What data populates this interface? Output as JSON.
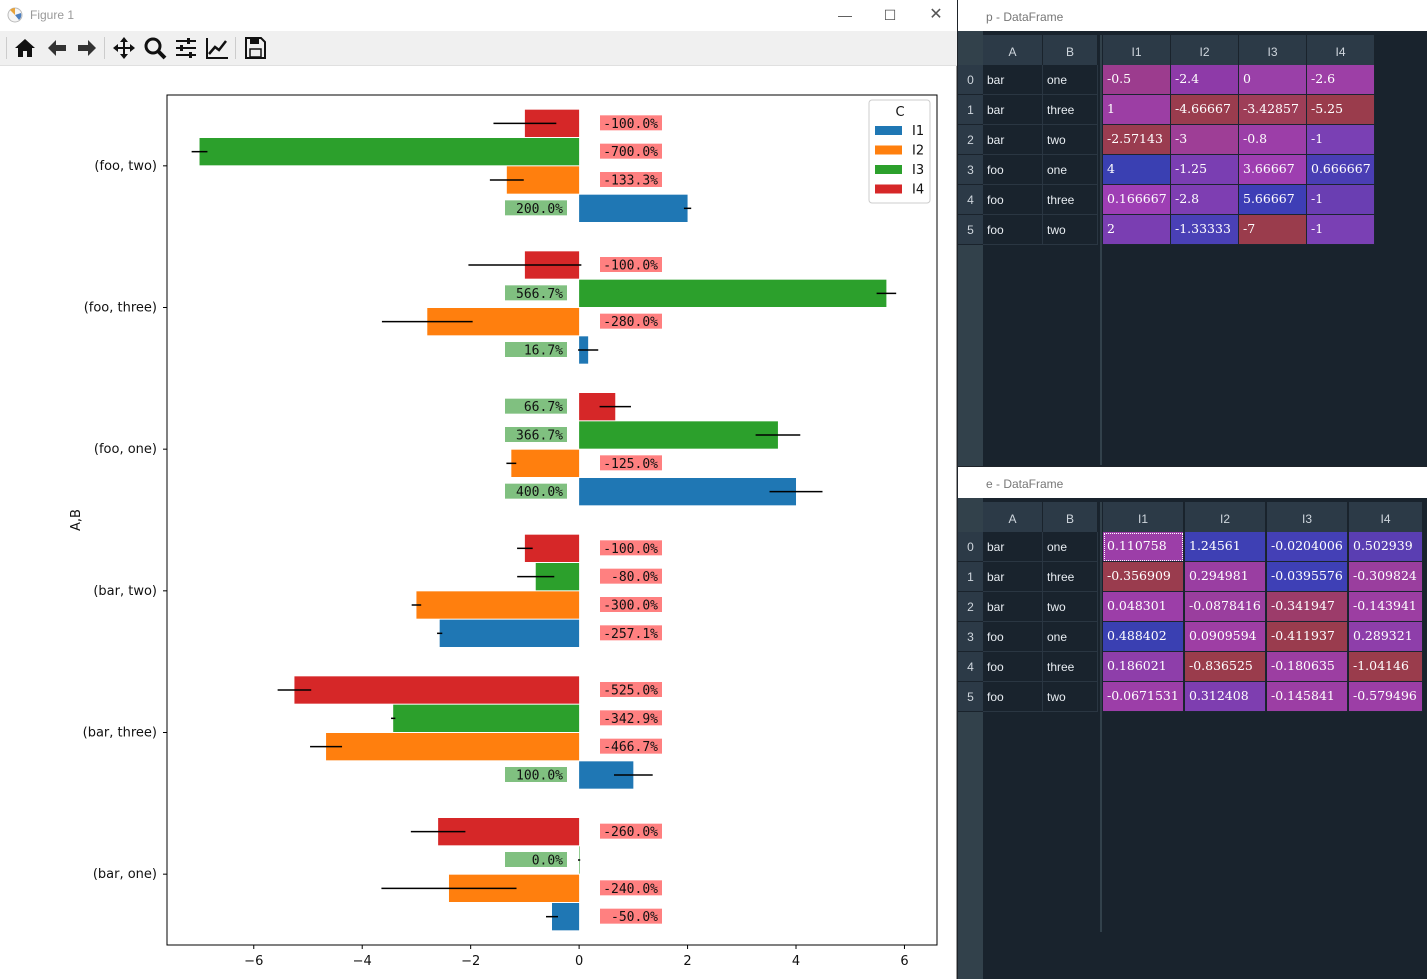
{
  "figure": {
    "title": "Figure 1",
    "toolbar": [
      "home-icon",
      "back-icon",
      "forward-icon",
      "pan-icon",
      "zoom-icon",
      "configure-subplots-icon",
      "edit-axis-icon",
      "save-icon"
    ]
  },
  "chart_data": {
    "type": "bar",
    "orientation": "horizontal",
    "ylabel": "A,B",
    "xlabel": "",
    "categories": [
      "(bar, one)",
      "(bar, three)",
      "(bar, two)",
      "(foo, one)",
      "(foo, three)",
      "(foo, two)"
    ],
    "xlim": [
      -7.6,
      6.6
    ],
    "xticks": [
      -6,
      -4,
      -2,
      0,
      2,
      4,
      6
    ],
    "legend_title": "C",
    "legend_position": "top-right",
    "series": [
      {
        "name": "I1",
        "color": "#1f77b4",
        "values": [
          -0.5,
          1,
          -2.57143,
          4,
          0.166667,
          2
        ],
        "err": [
          0.110758,
          -0.356909,
          0.048301,
          0.488402,
          0.186021,
          -0.0671531
        ],
        "pct": [
          "-50.0%",
          "100.0%",
          "-257.1%",
          "400.0%",
          "16.7%",
          "200.0%"
        ],
        "pct_pos": [
          false,
          true,
          false,
          true,
          true,
          true
        ]
      },
      {
        "name": "I2",
        "color": "#ff7f0e",
        "values": [
          -2.4,
          -4.66667,
          -3,
          -1.25,
          -2.8,
          -1.33333
        ],
        "err": [
          1.24561,
          0.294981,
          -0.0878416,
          0.0909594,
          -0.836525,
          0.312408
        ],
        "pct": [
          "-240.0%",
          "-466.7%",
          "-300.0%",
          "-125.0%",
          "-280.0%",
          "-133.3%"
        ],
        "pct_pos": [
          false,
          false,
          false,
          false,
          false,
          false
        ]
      },
      {
        "name": "I3",
        "color": "#2ca02c",
        "values": [
          0,
          -3.42857,
          -0.8,
          3.66667,
          5.66667,
          -7
        ],
        "err": [
          -0.0204006,
          -0.0395576,
          -0.341947,
          -0.411937,
          -0.180635,
          -0.145841
        ],
        "pct": [
          "0.0%",
          "-342.9%",
          "-80.0%",
          "366.7%",
          "566.7%",
          "-700.0%"
        ],
        "pct_pos": [
          true,
          false,
          false,
          true,
          true,
          false
        ]
      },
      {
        "name": "I4",
        "color": "#d62728",
        "values": [
          -2.6,
          -5.25,
          -1,
          0.666667,
          -1,
          -1
        ],
        "err": [
          0.502939,
          -0.309824,
          -0.143941,
          0.289321,
          -1.04146,
          -0.579496
        ],
        "pct": [
          "-260.0%",
          "-525.0%",
          "-100.0%",
          "66.7%",
          "-100.0%",
          "-100.0%"
        ],
        "pct_pos": [
          false,
          false,
          false,
          true,
          false,
          false
        ]
      }
    ]
  },
  "p_frame": {
    "title": "p - DataFrame",
    "index_header": [
      "A",
      "B"
    ],
    "columns": [
      "I1",
      "I2",
      "I3",
      "I4"
    ],
    "rows": [
      {
        "idx": "0",
        "A": "bar",
        "B": "one",
        "vals": [
          "-0.5",
          "-2.4",
          "0",
          "-2.6"
        ],
        "colors": [
          "#9c3c8e",
          "#8e3aa8",
          "#9a40a8",
          "#9d3fa6"
        ]
      },
      {
        "idx": "1",
        "A": "bar",
        "B": "three",
        "vals": [
          "1",
          "-4.66667",
          "-3.42857",
          "-5.25"
        ],
        "colors": [
          "#9c3ea4",
          "#9a3c4e",
          "#9e3e58",
          "#9a3c4c"
        ]
      },
      {
        "idx": "2",
        "A": "bar",
        "B": "two",
        "vals": [
          "-2.57143",
          "-3",
          "-0.8",
          "-1"
        ],
        "colors": [
          "#9a3c50",
          "#9e3e96",
          "#9c3ea8",
          "#7a40b4"
        ]
      },
      {
        "idx": "3",
        "A": "foo",
        "B": "one",
        "vals": [
          "4",
          "-1.25",
          "3.66667",
          "0.666667"
        ],
        "colors": [
          "#3a40b2",
          "#7a3eb2",
          "#9e3eb0",
          "#4a3eb4"
        ]
      },
      {
        "idx": "4",
        "A": "foo",
        "B": "three",
        "vals": [
          "0.166667",
          "-2.8",
          "5.66667",
          "-1"
        ],
        "colors": [
          "#9e3eb4",
          "#7e3eb2",
          "#3e3eb6",
          "#6a3eb2"
        ]
      },
      {
        "idx": "5",
        "A": "foo",
        "B": "two",
        "vals": [
          "2",
          "-1.33333",
          "-7",
          "-1"
        ],
        "colors": [
          "#7a3eb2",
          "#4a40b6",
          "#9a3c4c",
          "#7a40b4"
        ]
      }
    ]
  },
  "e_frame": {
    "title": "e - DataFrame",
    "index_header": [
      "A",
      "B"
    ],
    "columns": [
      "I1",
      "I2",
      "I3",
      "I4"
    ],
    "rows": [
      {
        "idx": "0",
        "A": "bar",
        "B": "one",
        "vals": [
          "0.110758",
          "1.24561",
          "-0.0204006",
          "0.502939"
        ],
        "colors": [
          "#9c3ea8",
          "#3e40b4",
          "#4440b6",
          "#5a3eb2"
        ]
      },
      {
        "idx": "1",
        "A": "bar",
        "B": "three",
        "vals": [
          "-0.356909",
          "0.294981",
          "-0.0395576",
          "-0.309824"
        ],
        "colors": [
          "#9a3c4e",
          "#9a3ea2",
          "#3e40b6",
          "#9a3e9e"
        ]
      },
      {
        "idx": "2",
        "A": "bar",
        "B": "two",
        "vals": [
          "0.048301",
          "-0.0878416",
          "-0.341947",
          "-0.143941"
        ],
        "colors": [
          "#9c3ea8",
          "#9a3e9e",
          "#9c3c6a",
          "#9c3ea2"
        ]
      },
      {
        "idx": "3",
        "A": "foo",
        "B": "one",
        "vals": [
          "0.488402",
          "0.0909594",
          "-0.411937",
          "0.289321"
        ],
        "colors": [
          "#3a40b2",
          "#9e3ea4",
          "#9a3c4e",
          "#8e3eaa"
        ]
      },
      {
        "idx": "4",
        "A": "foo",
        "B": "three",
        "vals": [
          "0.186021",
          "-0.836525",
          "-0.180635",
          "-1.04146"
        ],
        "colors": [
          "#8e3eaa",
          "#9a3c4c",
          "#9c3ea2",
          "#9a3c4c"
        ]
      },
      {
        "idx": "5",
        "A": "foo",
        "B": "two",
        "vals": [
          "-0.0671531",
          "0.312408",
          "-0.145841",
          "-0.579496"
        ],
        "colors": [
          "#9c3ea8",
          "#7e3eb0",
          "#9c3ea4",
          "#9c3ea6"
        ]
      }
    ]
  }
}
